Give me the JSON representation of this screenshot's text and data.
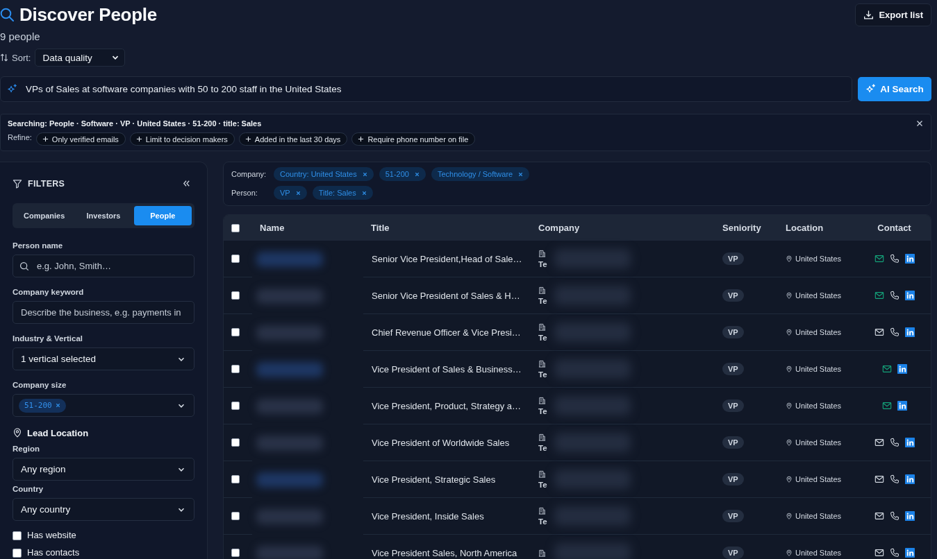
{
  "header": {
    "title": "Discover People",
    "count": "9 people",
    "export_button": "Export list"
  },
  "sort": {
    "label": "Sort:",
    "value": "Data quality"
  },
  "ai_search": {
    "query": "VPs of Sales at software companies with 50 to 200 staff in the United States",
    "button": "AI Search"
  },
  "search_summary": {
    "text": "Searching: People · Software · VP · United States · 51‑200 · title: Sales",
    "refine_label": "Refine:",
    "suggestions": [
      "Only verified emails",
      "Limit to decision makers",
      "Added in the last 30 days",
      "Require phone number on file"
    ]
  },
  "filters": {
    "title": "FILTERS",
    "tabs": [
      {
        "label": "Companies",
        "selected": false
      },
      {
        "label": "Investors",
        "selected": false
      },
      {
        "label": "People",
        "selected": true
      }
    ],
    "fields": [
      {
        "kind": "search",
        "label": "Person name",
        "placeholder": "e.g. John, Smith…"
      },
      {
        "kind": "text",
        "label": "Company keyword",
        "placeholder": "Describe the business, e.g. payments in"
      },
      {
        "kind": "select",
        "label": "Industry & Vertical",
        "value": "1 vertical selected"
      },
      {
        "kind": "chips",
        "label": "Company size",
        "chips": [
          "51‑200"
        ]
      }
    ],
    "location": {
      "title": "Lead Location",
      "fields": [
        {
          "kind": "select",
          "label": "Region",
          "value": "Any region"
        },
        {
          "kind": "select",
          "label": "Country",
          "value": "Any country"
        }
      ]
    },
    "checkboxes": [
      {
        "label": "Has website",
        "checked": false
      },
      {
        "label": "Has contacts",
        "checked": false
      }
    ]
  },
  "active_filters": [
    {
      "label": "Company:",
      "chips": [
        "Country: United States",
        "51‑200",
        "Technology / Software"
      ]
    },
    {
      "label": "Person:",
      "chips": [
        "VP",
        "Title: Sales"
      ]
    }
  ],
  "table": {
    "columns": [
      "Name",
      "Title",
      "Company",
      "Seniority",
      "Location",
      "Contact"
    ],
    "all_selected": false,
    "rows": [
      {
        "selected": false,
        "title": "Senior Vice President,Head of Sale…",
        "company": "Te",
        "seniority": "VP",
        "location": "United States",
        "email_verified": true,
        "phone": true,
        "linkedin": true
      },
      {
        "selected": false,
        "title": "Senior Vice President of Sales & H…",
        "company": "Te",
        "seniority": "VP",
        "location": "United States",
        "email_verified": true,
        "phone": true,
        "linkedin": true
      },
      {
        "selected": false,
        "title": "Chief Revenue Officer & Vice Presi…",
        "company": "Te",
        "seniority": "VP",
        "location": "United States",
        "email_verified": false,
        "phone": true,
        "linkedin": true
      },
      {
        "selected": false,
        "title": "Vice President of Sales & Business…",
        "company": "Te",
        "seniority": "VP",
        "location": "United States",
        "email_verified": true,
        "phone": false,
        "linkedin": true
      },
      {
        "selected": false,
        "title": "Vice President, Product, Strategy a…",
        "company": "Te",
        "seniority": "VP",
        "location": "United States",
        "email_verified": true,
        "phone": false,
        "linkedin": true
      },
      {
        "selected": false,
        "title": "Vice President of Worldwide Sales",
        "company": "Te",
        "seniority": "VP",
        "location": "United States",
        "email_verified": false,
        "phone": true,
        "linkedin": true
      },
      {
        "selected": false,
        "title": "Vice President, Strategic Sales",
        "company": "Te",
        "seniority": "VP",
        "location": "United States",
        "email_verified": false,
        "phone": true,
        "linkedin": true
      },
      {
        "selected": false,
        "title": "Vice President, Inside Sales",
        "company": "Te",
        "seniority": "VP",
        "location": "United States",
        "email_verified": false,
        "phone": true,
        "linkedin": true
      },
      {
        "selected": false,
        "title": "Vice President Sales, North America",
        "seniority": "VP",
        "location": "United States",
        "email_verified": false,
        "phone": true,
        "linkedin": true
      }
    ]
  }
}
